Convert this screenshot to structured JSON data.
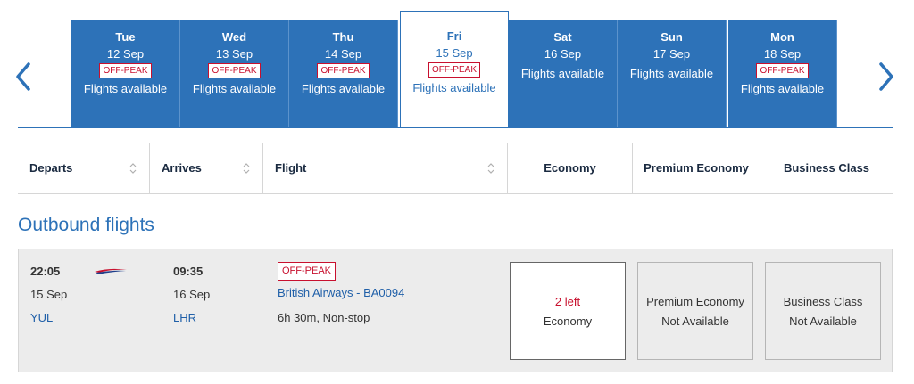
{
  "dates": [
    {
      "day": "Tue",
      "date": "12 Sep",
      "badge": "OFF-PEAK",
      "status": "Flights available"
    },
    {
      "day": "Wed",
      "date": "13 Sep",
      "badge": "OFF-PEAK",
      "status": "Flights available"
    },
    {
      "day": "Thu",
      "date": "14 Sep",
      "badge": "OFF-PEAK",
      "status": "Flights available"
    },
    {
      "day": "Fri",
      "date": "15 Sep",
      "badge": "OFF-PEAK",
      "status": "Flights available",
      "selected": true
    },
    {
      "day": "Sat",
      "date": "16 Sep",
      "badge": "",
      "status": "Flights available"
    },
    {
      "day": "Sun",
      "date": "17 Sep",
      "badge": "",
      "status": "Flights available"
    },
    {
      "day": "Mon",
      "date": "18 Sep",
      "badge": "OFF-PEAK",
      "status": "Flights available"
    }
  ],
  "nav": {
    "prev_icon": "chevron-left-icon",
    "next_icon": "chevron-right-icon"
  },
  "table_header": {
    "departs": "Departs",
    "arrives": "Arrives",
    "flight": "Flight",
    "economy": "Economy",
    "premium_economy": "Premium Economy",
    "business": "Business Class"
  },
  "outbound": {
    "title": "Outbound flights",
    "flight": {
      "depart_time": "22:05",
      "depart_date": "15 Sep",
      "depart_airport": "YUL",
      "arrive_time": "09:35",
      "arrive_date": "16 Sep",
      "arrive_airport": "LHR",
      "badge": "OFF-PEAK",
      "carrier_flight": "British Airways - BA0094",
      "duration": "6h 30m, Non-stop",
      "economy": {
        "seats": "2 left",
        "label": "Economy"
      },
      "premium_economy": {
        "label": "Premium Economy",
        "status": "Not Available"
      },
      "business": {
        "label": "Business Class",
        "status": "Not Available"
      }
    }
  },
  "colors": {
    "brand_blue": "#2d72b8",
    "offpeak_red": "#c8102e",
    "row_bg": "#ececec"
  }
}
